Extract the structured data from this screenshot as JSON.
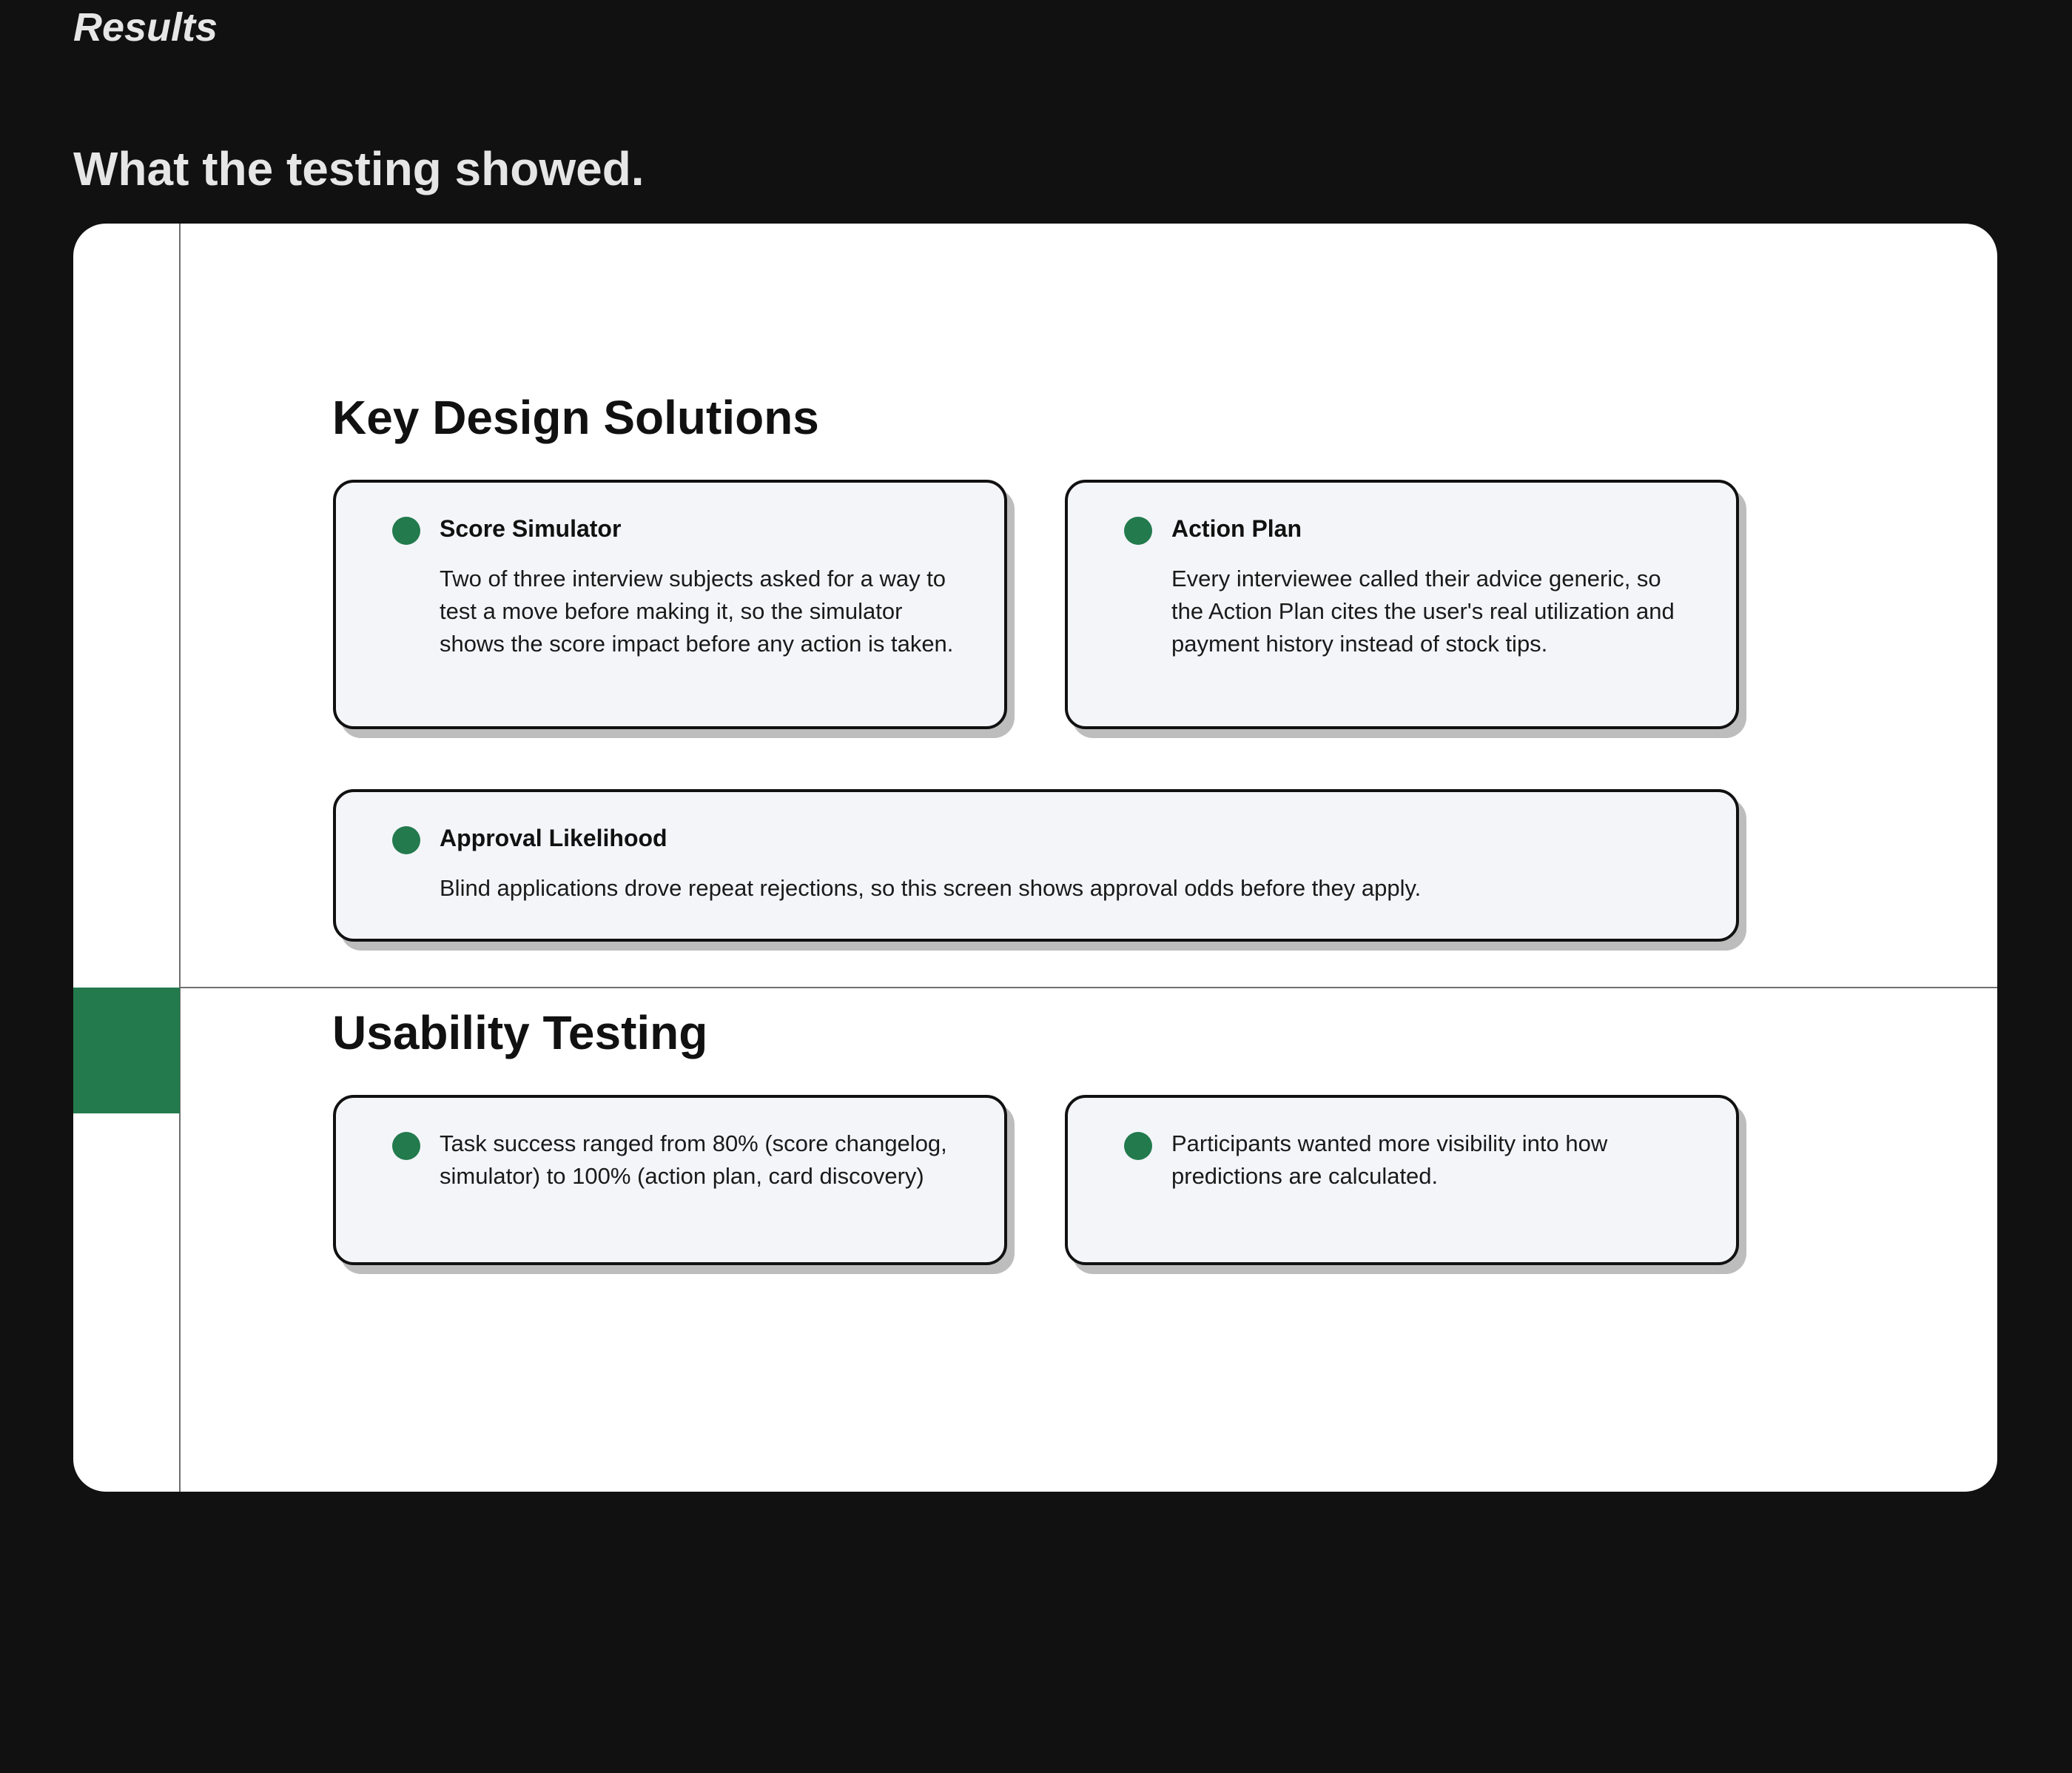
{
  "header": {
    "eyebrow": "Results",
    "heading": "What the testing showed."
  },
  "colors": {
    "background": "#111111",
    "panel": "#ffffff",
    "accent": "#227a4d",
    "card_background": "#f4f5f9",
    "card_border": "#111111",
    "card_shadow": "#bdbdbd"
  },
  "key_design_solutions": {
    "title": "Key Design Solutions",
    "cards": [
      {
        "title": "Score Simulator",
        "text": "Two of three interview subjects asked for a way to test a move before making it, so the simulator shows the score impact before any action is taken."
      },
      {
        "title": "Action Plan",
        "text": "Every interviewee called their advice generic, so the Action Plan cites the user's real utilization and payment history instead of stock tips."
      },
      {
        "title": "Approval Likelihood",
        "text": "Blind applications drove repeat rejections, so this screen shows approval odds before they apply."
      }
    ]
  },
  "usability_testing": {
    "title": "Usability Testing",
    "cards": [
      {
        "text": "Task success ranged from 80% (score changelog, simulator) to 100% (action plan, card discovery)"
      },
      {
        "text": "Participants wanted more visibility into how predictions are calculated."
      }
    ]
  }
}
